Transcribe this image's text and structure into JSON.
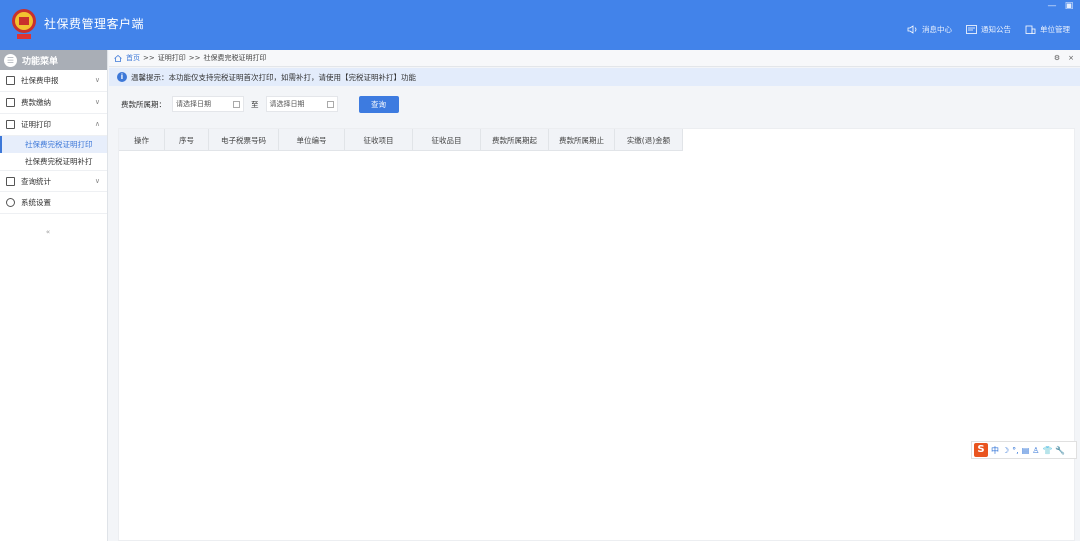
{
  "app": {
    "title": "社保费管理客户端",
    "window_controls": [
      "—",
      "▣"
    ]
  },
  "header_actions": [
    {
      "label": "消息中心",
      "icon": "speaker-icon"
    },
    {
      "label": "通知公告",
      "icon": "message-icon"
    },
    {
      "label": "单位管理",
      "icon": "building-icon"
    }
  ],
  "sidebar": {
    "title": "功能菜单",
    "items": [
      {
        "label": "社保费申报",
        "icon": "declare-icon",
        "chevron": "∨"
      },
      {
        "label": "费款缴纳",
        "icon": "pay-icon",
        "chevron": "∨"
      },
      {
        "label": "证明打印",
        "icon": "print-icon",
        "chevron": "∧",
        "children": [
          {
            "label": "社保费完税证明打印",
            "active": true
          },
          {
            "label": "社保费完税证明补打",
            "active": false
          }
        ]
      },
      {
        "label": "查询统计",
        "icon": "chart-icon",
        "chevron": "∨"
      },
      {
        "label": "系统设置",
        "icon": "gear-icon",
        "chevron": ""
      }
    ],
    "collapse": "«"
  },
  "breadcrumb": {
    "home": "首页",
    "sep": ">>",
    "level1": "证明打印",
    "level2": "社保费完税证明打印"
  },
  "tab_tools": [
    "⚙",
    "×"
  ],
  "tip": {
    "icon": "i",
    "text": "温馨提示：本功能仅支持完税证明首次打印，如需补打，请使用【完税证明补打】功能"
  },
  "filter": {
    "label": "费款所属期：",
    "start_placeholder": "请选择日期",
    "to": "至",
    "end_placeholder": "请选择日期",
    "query": "查询"
  },
  "table": {
    "columns": [
      "操作",
      "序号",
      "电子税票号码",
      "单位编号",
      "征收项目",
      "征收品目",
      "费款所属期起",
      "费款所属期止",
      "实缴(退)金额"
    ]
  },
  "ime": {
    "logo": "S",
    "items": [
      "中",
      "☽",
      "°,",
      "▤",
      "♙",
      "👕",
      "🔧"
    ]
  },
  "colors": {
    "header": "#4283ea",
    "accent": "#3d78d8",
    "tip_bg": "#e3ecfb"
  }
}
